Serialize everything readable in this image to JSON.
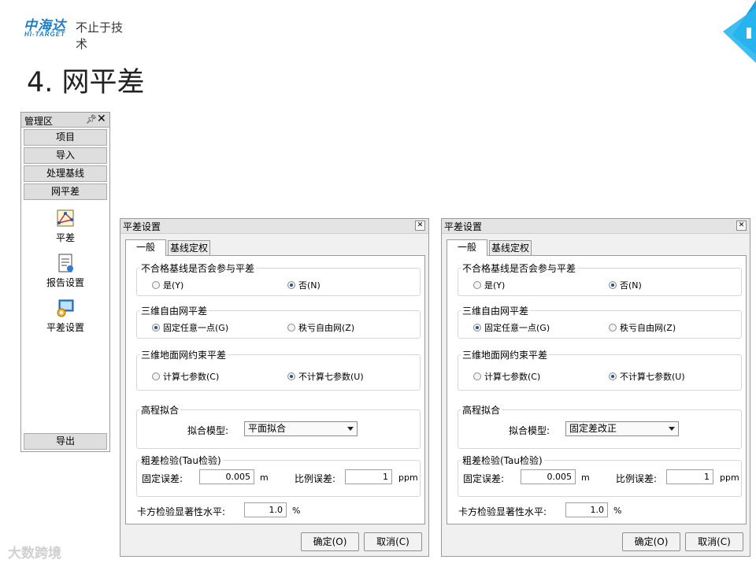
{
  "header": {
    "logo_cn": "中海达",
    "logo_en": "HI-TARGET",
    "slogan": "不止于技术",
    "title": "4. 网平差"
  },
  "management": {
    "title": "管理区",
    "pin_icon": "pin-icon",
    "close_icon": "close-icon",
    "buttons": [
      "项目",
      "导入",
      "处理基线",
      "网平差"
    ],
    "items": [
      {
        "label": "平差",
        "icon": "adjust-icon"
      },
      {
        "label": "报告设置",
        "icon": "report-icon"
      },
      {
        "label": "平差设置",
        "icon": "settings-icon"
      }
    ],
    "export": "导出"
  },
  "dialogs": [
    {
      "title": "平差设置",
      "tabs": [
        "一般",
        "基线定权"
      ],
      "group1": {
        "label": "不合格基线是否会参与平差",
        "opt_yes": "是(Y)",
        "opt_no": "否(N)",
        "selected": "no"
      },
      "group2": {
        "label": "三维自由网平差",
        "opt_a": "固定任意一点(G)",
        "opt_b": "秩亏自由网(Z)",
        "selected": "a"
      },
      "group3": {
        "label": "三维地面网约束平差",
        "opt_a": "计算七参数(C)",
        "opt_b": "不计算七参数(U)",
        "selected": "b"
      },
      "group4": {
        "label": "高程拟合",
        "model_label": "拟合模型:",
        "model_value": "平面拟合"
      },
      "group5": {
        "label": "粗差检验(Tau检验)",
        "fixed_label": "固定误差:",
        "fixed_value": "0.005",
        "fixed_unit": "m",
        "ratio_label": "比例误差:",
        "ratio_value": "1",
        "ratio_unit": "ppm"
      },
      "chi": {
        "label": "卡方检验显著性水平:",
        "value": "1.0",
        "unit": "%"
      },
      "ok": "确定(O)",
      "cancel": "取消(C)"
    },
    {
      "title": "平差设置",
      "tabs": [
        "一般",
        "基线定权"
      ],
      "group1": {
        "label": "不合格基线是否会参与平差",
        "opt_yes": "是(Y)",
        "opt_no": "否(N)",
        "selected": "no"
      },
      "group2": {
        "label": "三维自由网平差",
        "opt_a": "固定任意一点(G)",
        "opt_b": "秩亏自由网(Z)",
        "selected": "a"
      },
      "group3": {
        "label": "三维地面网约束平差",
        "opt_a": "计算七参数(C)",
        "opt_b": "不计算七参数(U)",
        "selected": "b"
      },
      "group4": {
        "label": "高程拟合",
        "model_label": "拟合模型:",
        "model_value": "固定差改正"
      },
      "group5": {
        "label": "粗差检验(Tau检验)",
        "fixed_label": "固定误差:",
        "fixed_value": "0.005",
        "fixed_unit": "m",
        "ratio_label": "比例误差:",
        "ratio_value": "1",
        "ratio_unit": "ppm"
      },
      "chi": {
        "label": "卡方检验显著性水平:",
        "value": "1.0",
        "unit": "%"
      },
      "ok": "确定(O)",
      "cancel": "取消(C)"
    }
  ],
  "watermark": "大数跨境",
  "colors": {
    "brand": "#1f7fc5",
    "accent": "#1aa3dd"
  }
}
